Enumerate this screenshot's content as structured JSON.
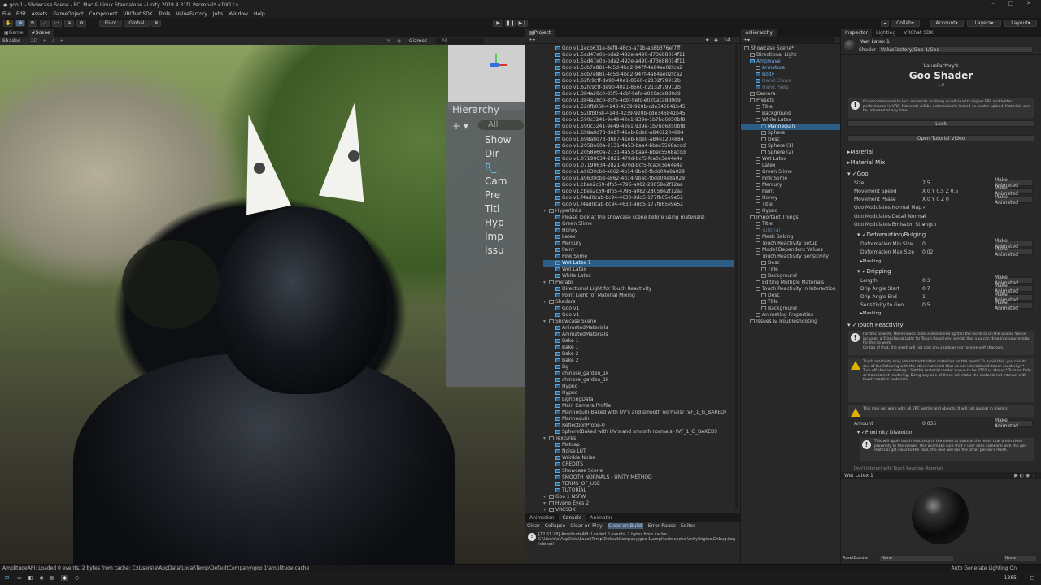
{
  "window": {
    "title": "goo 1 - Showcase Scene - PC, Mac & Linux Standalone - Unity 2019.4.31f1 Personal* <DX11>"
  },
  "menu": [
    "File",
    "Edit",
    "Assets",
    "GameObject",
    "Component",
    "VRChat SDK",
    "Tools",
    "ValueFactory",
    "Jobs",
    "Window",
    "Help"
  ],
  "toolbar": {
    "pivot": "Pivot",
    "global": "Global",
    "collab": "Collab",
    "account": "Account",
    "layers": "Layers",
    "layout": "Layout"
  },
  "views": {
    "game_tab": "Game",
    "scene_tab": "Scene",
    "shading": "Shaded",
    "gizmos": "Gizmos",
    "search": "All"
  },
  "scene_overlay": {
    "title": "Hierarchy",
    "search": "All",
    "items": [
      "Show",
      "Dir",
      "R_",
      "",
      "",
      "Cam",
      "Pre",
      "Titl",
      "Hyp",
      "Imp",
      "Issu"
    ]
  },
  "project": {
    "tab": "Project",
    "items": [
      "Goo v1.1ecb631e-8ef8-48cb-a71b-ab8b376ef7ff",
      "Goo v1.5ad47e0b-bda2-492e-a490-d73688014f11",
      "Goo v1.5ad47e0b-bda2-492e-a490-d73688014f11",
      "Goo v1.5cb7e881-4c5d-4bd2-947f-4a84ae02fca2",
      "Goo v1.5cb7e881-4c5d-4bd2-947f-4a84ae02fca2",
      "Goo v1.62fc9cff-de90-40a1-8560-d2132f79912b",
      "Goo v1.62fc9cff-de90-40a1-8560-d2132f79912b",
      "Goo v1.384a28c0-85f5-4cbf-9efc-e020aca8d0d9",
      "Goo v1.384a28c0-85f5-4cbf-9efc-e020aca8d0d9",
      "Goo v1.520fb068-4143-4239-920b-cde346841b45",
      "Goo v1.520fb068-4143-4239-920b-cde346841b45",
      "Goo v1.590c3241-9e49-42e1-939e-1b7bd6850bf8",
      "Goo v1.590c3241-9e49-42e1-939e-1b7bd6850bf8",
      "Goo v1.698a8d73-d687-41eb-8de0-a8461204884",
      "Goo v1.698a8d73-d687-41eb-8de0-a8461204884",
      "Goo v1.2058e60a-2131-4a53-baa4-bbec5568acdd",
      "Goo v1.2058e60a-2131-4a53-baa4-bbec5568acdd",
      "Goo v1.07190634-2821-470d-bcf5-fca0c3e64e4a",
      "Goo v1.07190634-2821-470d-bcf5-fca0c3e64e4a",
      "Goo v1.a9630cb8-e862-4b14-9ba0-fbdd04e8a029",
      "Goo v1.a9630cb8-e862-4b14-9ba0-fbdd04e8a029",
      "Goo v1.cbee2c69-dfb5-4796-a082-28058e2f12aa",
      "Goo v1.cbee2c69-dfb5-4796-a082-28058e2f12aa",
      "Goo v1.f4ad0cab-bc94-4630-9dd5-177fb65e9e52",
      "Goo v1.f4ad0cab-bc94-4630-9dd5-177fb65e9e52",
      "Hyperlinks",
      "Please look at the showcase scene before using materials!",
      "Green Slime",
      "Honey",
      "Latex",
      "Mercury",
      "Paint",
      "Pink Slime",
      "Wet Latex 1",
      "Wet Latex",
      "White Latex",
      "Prefabs",
      "Directional Light for Touch Reactivity",
      "Point Light for Material Mixing",
      "Shaders",
      "Goo v1",
      "Goo v1",
      "Showcase Scene",
      "AnimatedMaterials",
      "AnimatedMaterials",
      "Bake 1",
      "Bake 1",
      "Bake 2",
      "Bake 2",
      "Bg",
      "chinese_garden_1k",
      "chinese_garden_1k",
      "Hypno",
      "Hypno",
      "LightingData",
      "Main Camera Profile",
      "Mannequin(Baked with UV's and smooth normals) (VF_1_G_BAKED)",
      "Mannequin",
      "ReflectionProbe-0",
      "Sphere(Baked with UV's and smooth normals) (VF_1_G_BAKED)",
      "Textures",
      "Matcap",
      "Noise LUT",
      "Wrinkle Noise",
      "CREDITS",
      "Showcase Scene",
      "SMOOTH NORMALS - UNITY METHOD",
      "TERMS_OF_USE",
      "TUTORIAL",
      "Goo 1 NSFW",
      "Hypno Eyes 2",
      "VRCSDK"
    ]
  },
  "hierarchy": {
    "tab": "Hierarchy",
    "items": [
      "Showcase Scene*",
      "Directional Light",
      "Ampwave",
      "Armature",
      "Body",
      "Hand.Claws",
      "Hand.Paws",
      "Camera",
      "Presets",
      "Title",
      "Background",
      "White Latex",
      "Mannequin",
      "Sphere",
      "Desc",
      "Sphere (1)",
      "Sphere (2)",
      "Wet Latex",
      "Latex",
      "Green Slime",
      "Pink Slime",
      "Mercury",
      "Paint",
      "Honey",
      "Title",
      "Hypno",
      "Important Things",
      "Title",
      "Tutorial",
      "Mesh Baking",
      "Touch Reactivity Setup",
      "Model Dependent Values",
      "Touch Reactivity Sensitivity",
      "Desc",
      "Title",
      "Background",
      "Editing Multiple Materials",
      "Touch Reactivity in Interaction",
      "Desc",
      "Title",
      "Background",
      "Animating Properties",
      "Issues & Troubleshooting"
    ]
  },
  "inspector": {
    "tabs": [
      "Inspector",
      "Lighting",
      "VRChat SDK"
    ],
    "material_name": "Wet Latex 1",
    "shader_label": "Shader",
    "shader_value": "ValueFactory/Goo 1/Goo",
    "brand": "ValueFactory's",
    "product": "Goo Shader",
    "version": "1.0",
    "lock_note": "It's recommended to lock materials as doing so will lead to higher FPS and better performance in VRC. Materials will be automatically locked on avatar upload. Materials can be unlocked at any time.",
    "lock_btn": "Lock",
    "tutorial_btn": "Open Tutorial Video",
    "sections": {
      "material": "Material",
      "mix": "Material Mix",
      "goo": "Goo",
      "deform": "Deformation/Bulging",
      "masking": "Masking",
      "dripping": "Dripping",
      "masking2": "Masking",
      "touch": "Touch Reactivity",
      "proximity": "Proximity Distortion"
    },
    "goo_props": [
      {
        "label": "Size",
        "value": "7.5",
        "btn": "Make Animated"
      },
      {
        "label": "Movement Speed",
        "value": "X 0    Y 0.5    Z 0.5",
        "btn": "Make Animated"
      },
      {
        "label": "Movement Phase",
        "value": "X 0    Y 0    Z 0",
        "btn": "Make Animated"
      },
      {
        "label": "Goo Modulates Normal Map",
        "value": "✓",
        "btn": ""
      },
      {
        "label": "Goo Modulates Detail Normal",
        "value": "✓",
        "btn": ""
      },
      {
        "label": "Goo Modulates Emission Strength",
        "value": "✓",
        "btn": ""
      }
    ],
    "deform_props": [
      {
        "label": "Deformation Min Size",
        "value": "0",
        "btn": "Make Animated"
      },
      {
        "label": "Deformation Max Size",
        "value": "0.02",
        "btn": "Make Animated"
      }
    ],
    "drip_props": [
      {
        "label": "Length",
        "value": "0.3",
        "btn": "Make Animated"
      },
      {
        "label": "Drip Angle Start",
        "value": "0.7",
        "btn": "Make Animated"
      },
      {
        "label": "Drip Angle End",
        "value": "1",
        "btn": "Make Animated"
      },
      {
        "label": "Sensitivity to Goo",
        "value": "0.5",
        "btn": "Make Animated"
      }
    ],
    "touch_note1": "For this to work, there needs to be a directional light in the world or on the avatar. We've included a 'Directional Light for Touch Reactivity' prefab that you can drag into your avatar for this to work.",
    "touch_note1b": "On top of that, the mesh will not cast any shadows nor receive self shadows.",
    "touch_note2": "Touch reactivity may interact with other materials on the mesh! To avoid this, you can do one of the following with the other materials that do not interact with touch reactivity: * Turn off shadow casting * Set the material render queue to be 2501 or above * Turn on fade or transparent rendering. Doing any one of these will make the material not interact with touch reactive materials.",
    "touch_note3": "This may not work with all VRC worlds and objects. It will not appear in mirrors.",
    "amount_label": "Amount",
    "amount_value": "0.035",
    "amount_btn": "Make Animated",
    "prox_note": "This will apply touch reactivity to the mesh to parts of the mesh that are in close proximity to the viewer. This will make sure that if user sees someone with the goo material get close to the face, the user will see the other person's mesh.",
    "cutoff": "Don't Interact with Touch Reactive Materials",
    "preview_name": "Wet Latex 1",
    "assetbundle_label": "AssetBundle",
    "assetbundle_value": "None",
    "assetbundle_value2": "None"
  },
  "console": {
    "tabs": [
      "Animation",
      "Console",
      "Animator"
    ],
    "buttons": [
      "Clear",
      "Collapse",
      "Clear on Play",
      "Clear on Build",
      "Error Pause",
      "Editor"
    ],
    "log": "[12:51:28] AmplitudeAPI: Loaded 0 events, 2 bytes from cache: C:\\Users\\a\\AppData\\Local\\Temp\\DefaultCompany\\goo 1\\amplitude.cache UnityEngine.Debug:Log (object)"
  },
  "status": {
    "text": "AmplitudeAPI: Loaded 0 events, 2 bytes from cache: C:\\Users\\a\\AppData\\Local\\Temp\\DefaultCompany\\goo 1\\amplitude.cache",
    "right": "Auto Generate Lighting On"
  },
  "taskbar": {
    "time": "1385"
  }
}
